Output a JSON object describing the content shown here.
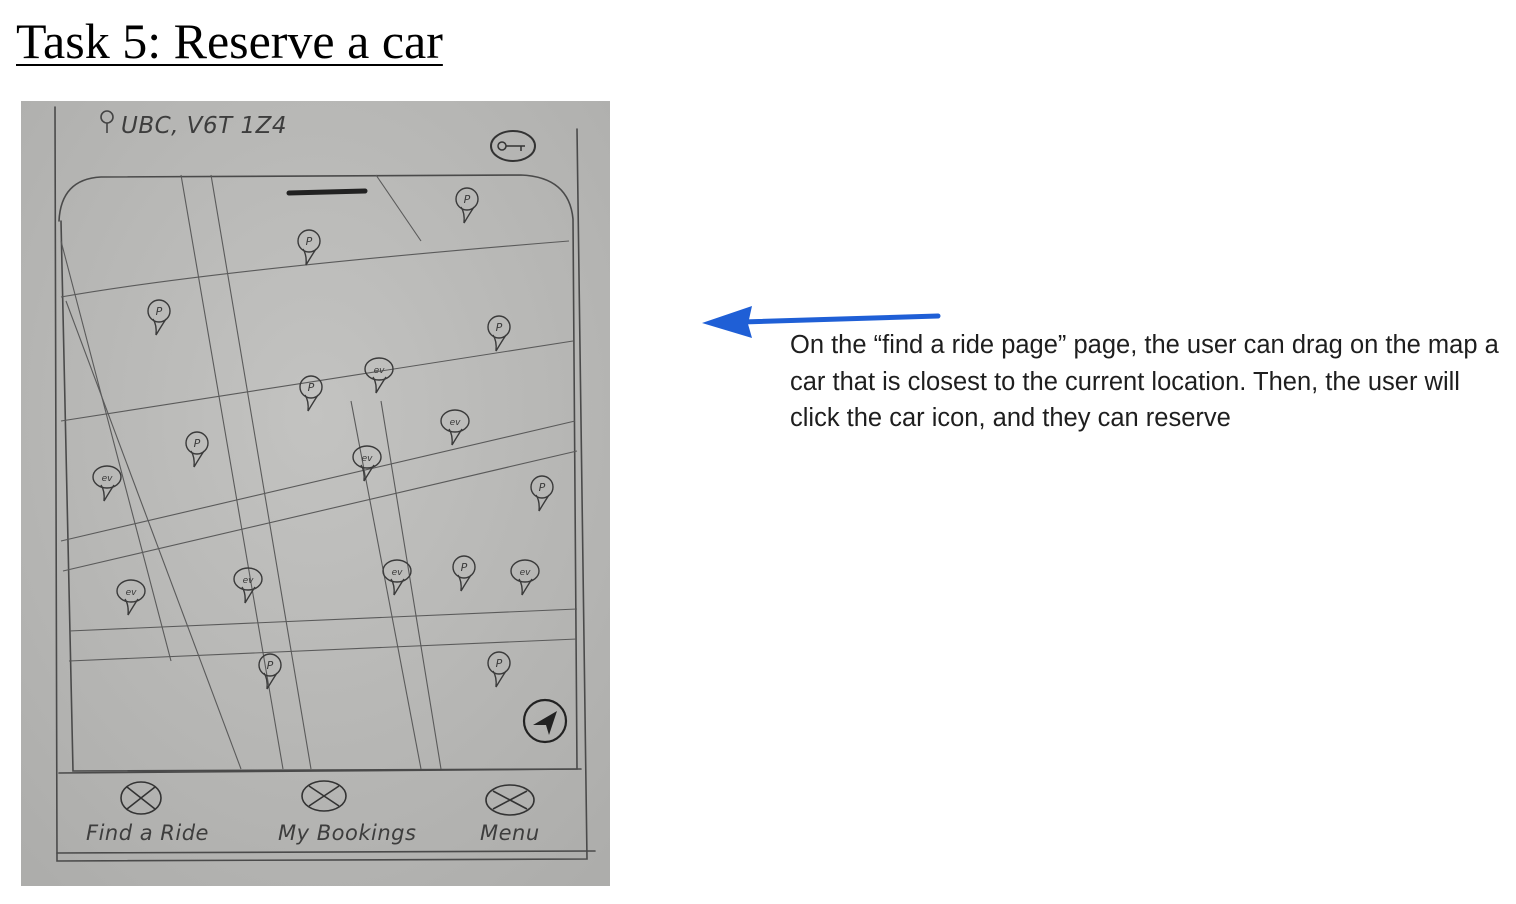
{
  "title": "Task 5: Reserve a car",
  "sketch": {
    "location": "UBC, V6T 1Z4",
    "pin_p_label": "P",
    "pin_ev_label": "ev",
    "nav": [
      {
        "label": "Find a Ride"
      },
      {
        "label": "My Bookings"
      },
      {
        "label": "Menu"
      }
    ]
  },
  "annotation": {
    "text": "On the “find a ride page” page, the user can drag on the map a car that is closest to the current location. Then, the user will click the car icon, and they can reserve"
  },
  "colors": {
    "paper": "#b9b9b7",
    "pencil": "#4a4a4a",
    "arrow": "#1f5fd6",
    "text": "#1e1e1e"
  }
}
